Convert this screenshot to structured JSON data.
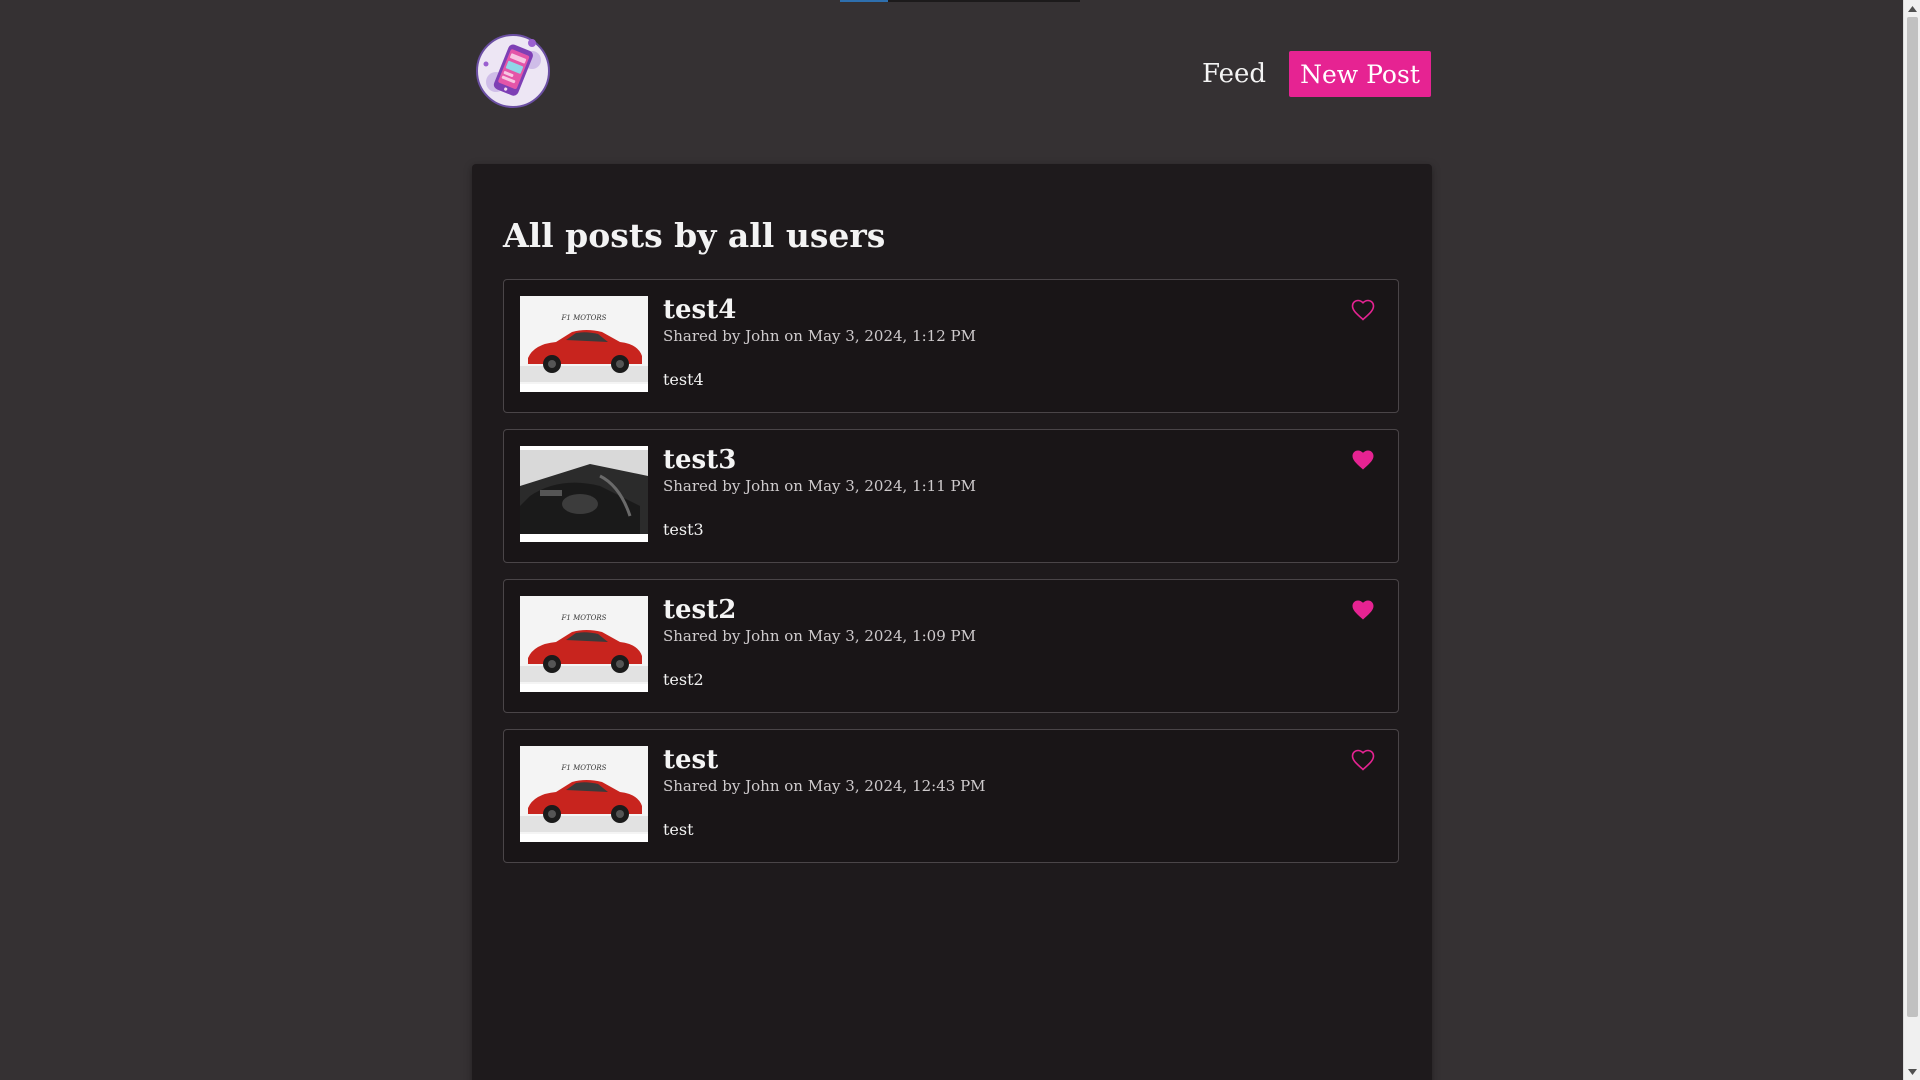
{
  "nav": {
    "feed_label": "Feed",
    "new_post_label": "New Post"
  },
  "page": {
    "title": "All posts by all users"
  },
  "posts": [
    {
      "title": "test4",
      "meta": "Shared by John on May 3, 2024, 1:12 PM",
      "body": "test4",
      "liked": false,
      "image": "red-car-rear",
      "thumb_text": "F1 MOTORS"
    },
    {
      "title": "test3",
      "meta": "Shared by John on May 3, 2024, 1:11 PM",
      "body": "test3",
      "liked": true,
      "image": "car-interior",
      "thumb_text": ""
    },
    {
      "title": "test2",
      "meta": "Shared by John on May 3, 2024, 1:09 PM",
      "body": "test2",
      "liked": true,
      "image": "red-car-side",
      "thumb_text": "F1 MOTORS"
    },
    {
      "title": "test",
      "meta": "Shared by John on May 3, 2024, 12:43 PM",
      "body": "test",
      "liked": false,
      "image": "red-car-front",
      "thumb_text": "F1 MOTORS"
    }
  ],
  "colors": {
    "accent": "#e62392",
    "background": "#353133",
    "panel": "#1e1a1c",
    "card": "#191517",
    "card_border": "#4a4548"
  },
  "icons": {
    "logo": "phone-app-logo",
    "like_empty": "heart-outline-icon",
    "like_filled": "heart-filled-icon"
  },
  "loading_progress": 0.2
}
